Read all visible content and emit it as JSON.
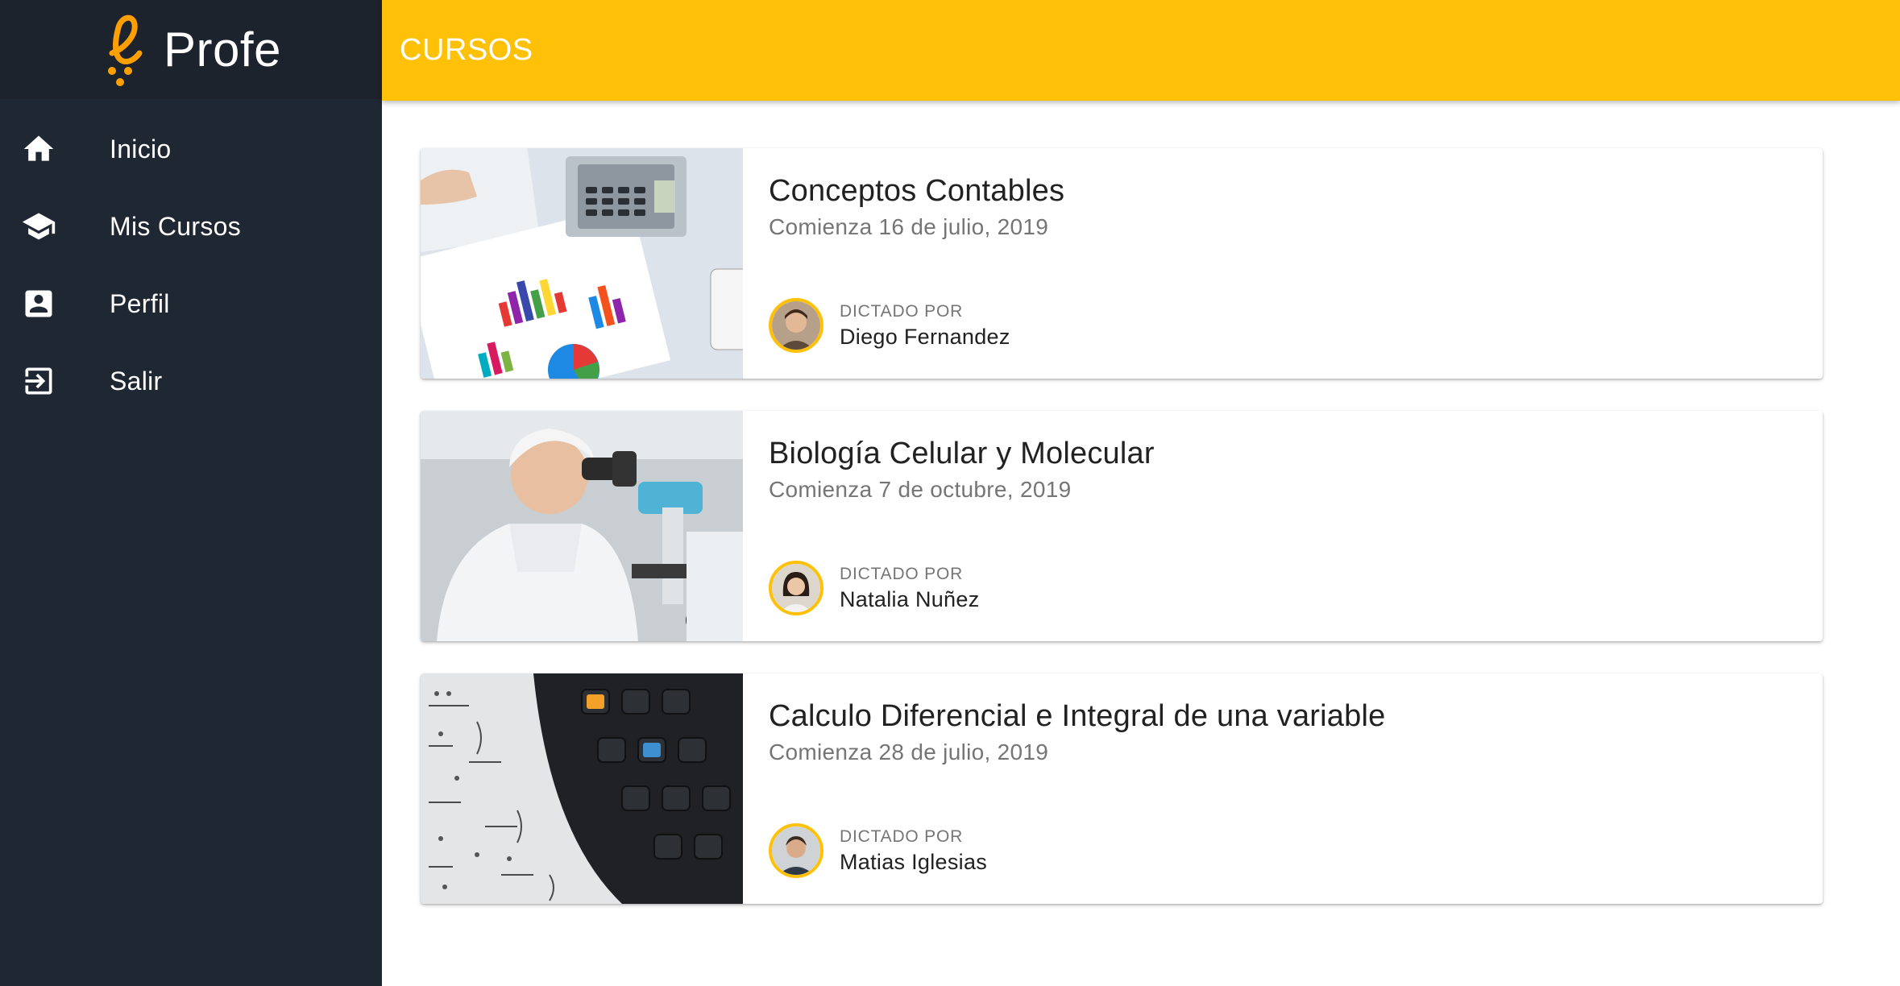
{
  "brand": {
    "name": "Profe",
    "logo_icon": "e-logo-icon"
  },
  "colors": {
    "accent": "#ffc107",
    "sidebar": "#1f2732",
    "text_dark": "#212121",
    "text_muted": "#757575"
  },
  "sidebar": {
    "items": [
      {
        "label": "Inicio",
        "icon": "home-icon"
      },
      {
        "label": "Mis Cursos",
        "icon": "graduation-cap-icon"
      },
      {
        "label": "Perfil",
        "icon": "account-box-icon"
      },
      {
        "label": "Salir",
        "icon": "exit-icon"
      }
    ]
  },
  "header": {
    "title": "CURSOS"
  },
  "courses": [
    {
      "title": "Conceptos Contables",
      "date": "Comienza 16 de julio, 2019",
      "dictado_label": "DICTADO POR",
      "teacher": "Diego Fernandez",
      "image": "accounting-charts-image"
    },
    {
      "title": "Biología Celular y Molecular",
      "date": "Comienza 7 de octubre, 2019",
      "dictado_label": "DICTADO POR",
      "teacher": "Natalia Nuñez",
      "image": "microscope-scientist-image"
    },
    {
      "title": "Calculo Diferencial e Integral de una variable",
      "date": "Comienza 28 de julio, 2019",
      "dictado_label": "DICTADO POR",
      "teacher": "Matias Iglesias",
      "image": "calculator-equations-image"
    }
  ]
}
